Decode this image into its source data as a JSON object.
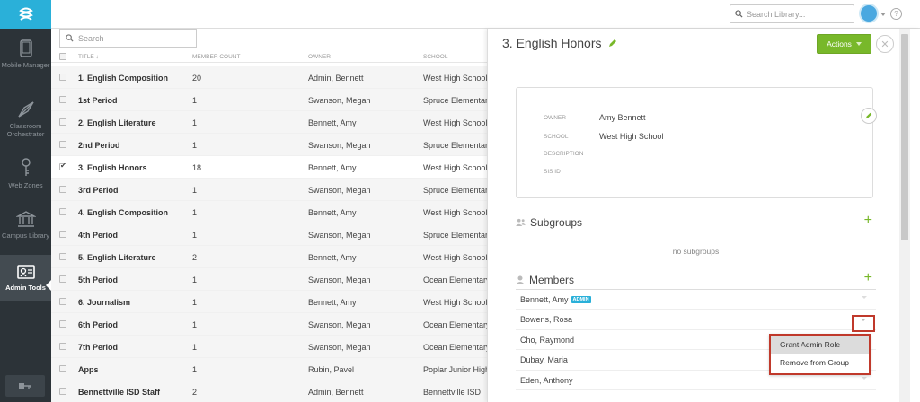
{
  "nav": {
    "items": [
      {
        "label": "Mobile Manager",
        "icon": "tablet-icon"
      },
      {
        "label": "Classroom Orchestrator",
        "icon": "compass-icon"
      },
      {
        "label": "Web Zones",
        "icon": "web-zones-icon"
      },
      {
        "label": "Campus Library",
        "icon": "library-icon"
      },
      {
        "label": "Admin Tools",
        "icon": "admin-tools-icon"
      }
    ],
    "active": "Admin Tools"
  },
  "topbar": {
    "search_placeholder": "Search Library...",
    "help_label": "?"
  },
  "table": {
    "search_placeholder": "Search",
    "columns": {
      "title": "TITLE ↓",
      "member_count": "MEMBER COUNT",
      "owner": "OWNER",
      "school": "SCHOOL"
    },
    "rows": [
      {
        "title": "1. English Composition",
        "count": "20",
        "owner": "Admin, Bennett",
        "school": "West High School",
        "checked": false
      },
      {
        "title": "1st Period",
        "count": "1",
        "owner": "Swanson, Megan",
        "school": "Spruce Elementary",
        "checked": false
      },
      {
        "title": "2. English Literature",
        "count": "1",
        "owner": "Bennett, Amy",
        "school": "West High School",
        "checked": false
      },
      {
        "title": "2nd Period",
        "count": "1",
        "owner": "Swanson, Megan",
        "school": "Spruce Elementary",
        "checked": false
      },
      {
        "title": "3. English Honors",
        "count": "18",
        "owner": "Bennett, Amy",
        "school": "West High School",
        "checked": true
      },
      {
        "title": "3rd Period",
        "count": "1",
        "owner": "Swanson, Megan",
        "school": "Spruce Elementary",
        "checked": false
      },
      {
        "title": "4. English Composition",
        "count": "1",
        "owner": "Bennett, Amy",
        "school": "West High School",
        "checked": false
      },
      {
        "title": "4th Period",
        "count": "1",
        "owner": "Swanson, Megan",
        "school": "Spruce Elementary",
        "checked": false
      },
      {
        "title": "5. English Literature",
        "count": "2",
        "owner": "Bennett, Amy",
        "school": "West High School",
        "checked": false
      },
      {
        "title": "5th Period",
        "count": "1",
        "owner": "Swanson, Megan",
        "school": "Ocean Elementary",
        "checked": false
      },
      {
        "title": "6. Journalism",
        "count": "1",
        "owner": "Bennett, Amy",
        "school": "West High School",
        "checked": false
      },
      {
        "title": "6th Period",
        "count": "1",
        "owner": "Swanson, Megan",
        "school": "Ocean Elementary",
        "checked": false
      },
      {
        "title": "7th Period",
        "count": "1",
        "owner": "Swanson, Megan",
        "school": "Ocean Elementary",
        "checked": false
      },
      {
        "title": "Apps",
        "count": "1",
        "owner": "Rubin, Pavel",
        "school": "Poplar Junior High",
        "checked": false
      },
      {
        "title": "Bennettville ISD Staff",
        "count": "2",
        "owner": "Admin, Bennett",
        "school": "Bennettville ISD",
        "checked": false
      }
    ]
  },
  "panel": {
    "title": "3. English Honors",
    "actions_label": "Actions",
    "close_label": "✕",
    "info": {
      "owner_label": "OWNER",
      "owner_value": "Amy Bennett",
      "school_label": "SCHOOL",
      "school_value": "West High School",
      "description_label": "DESCRIPTION",
      "sis_label": "SIS ID"
    },
    "subgroups": {
      "title": "Subgroups",
      "empty": "no subgroups"
    },
    "members": {
      "title": "Members",
      "list": [
        {
          "name": "Bennett, Amy",
          "badge": "ADMIN"
        },
        {
          "name": "Bowens, Rosa",
          "badge": ""
        },
        {
          "name": "Cho, Raymond",
          "badge": ""
        },
        {
          "name": "Dubay, Maria",
          "badge": ""
        },
        {
          "name": "Eden, Anthony",
          "badge": ""
        }
      ]
    },
    "menu": {
      "items": [
        "Grant Admin Role",
        "Remove from Group"
      ]
    }
  },
  "colors": {
    "accent": "#2ab0d9",
    "action_green": "#78b82a",
    "highlight_red": "#c0392b",
    "nav_bg": "#2c3338"
  }
}
